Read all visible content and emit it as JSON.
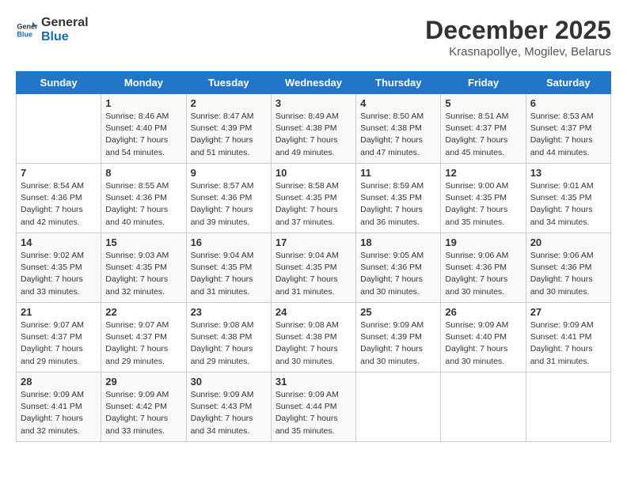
{
  "header": {
    "logo_general": "General",
    "logo_blue": "Blue",
    "title": "December 2025",
    "subtitle": "Krasnapollye, Mogilev, Belarus"
  },
  "weekdays": [
    "Sunday",
    "Monday",
    "Tuesday",
    "Wednesday",
    "Thursday",
    "Friday",
    "Saturday"
  ],
  "weeks": [
    [
      {
        "day": "",
        "info": ""
      },
      {
        "day": "1",
        "info": "Sunrise: 8:46 AM\nSunset: 4:40 PM\nDaylight: 7 hours\nand 54 minutes."
      },
      {
        "day": "2",
        "info": "Sunrise: 8:47 AM\nSunset: 4:39 PM\nDaylight: 7 hours\nand 51 minutes."
      },
      {
        "day": "3",
        "info": "Sunrise: 8:49 AM\nSunset: 4:38 PM\nDaylight: 7 hours\nand 49 minutes."
      },
      {
        "day": "4",
        "info": "Sunrise: 8:50 AM\nSunset: 4:38 PM\nDaylight: 7 hours\nand 47 minutes."
      },
      {
        "day": "5",
        "info": "Sunrise: 8:51 AM\nSunset: 4:37 PM\nDaylight: 7 hours\nand 45 minutes."
      },
      {
        "day": "6",
        "info": "Sunrise: 8:53 AM\nSunset: 4:37 PM\nDaylight: 7 hours\nand 44 minutes."
      }
    ],
    [
      {
        "day": "7",
        "info": "Sunrise: 8:54 AM\nSunset: 4:36 PM\nDaylight: 7 hours\nand 42 minutes."
      },
      {
        "day": "8",
        "info": "Sunrise: 8:55 AM\nSunset: 4:36 PM\nDaylight: 7 hours\nand 40 minutes."
      },
      {
        "day": "9",
        "info": "Sunrise: 8:57 AM\nSunset: 4:36 PM\nDaylight: 7 hours\nand 39 minutes."
      },
      {
        "day": "10",
        "info": "Sunrise: 8:58 AM\nSunset: 4:35 PM\nDaylight: 7 hours\nand 37 minutes."
      },
      {
        "day": "11",
        "info": "Sunrise: 8:59 AM\nSunset: 4:35 PM\nDaylight: 7 hours\nand 36 minutes."
      },
      {
        "day": "12",
        "info": "Sunrise: 9:00 AM\nSunset: 4:35 PM\nDaylight: 7 hours\nand 35 minutes."
      },
      {
        "day": "13",
        "info": "Sunrise: 9:01 AM\nSunset: 4:35 PM\nDaylight: 7 hours\nand 34 minutes."
      }
    ],
    [
      {
        "day": "14",
        "info": "Sunrise: 9:02 AM\nSunset: 4:35 PM\nDaylight: 7 hours\nand 33 minutes."
      },
      {
        "day": "15",
        "info": "Sunrise: 9:03 AM\nSunset: 4:35 PM\nDaylight: 7 hours\nand 32 minutes."
      },
      {
        "day": "16",
        "info": "Sunrise: 9:04 AM\nSunset: 4:35 PM\nDaylight: 7 hours\nand 31 minutes."
      },
      {
        "day": "17",
        "info": "Sunrise: 9:04 AM\nSunset: 4:35 PM\nDaylight: 7 hours\nand 31 minutes."
      },
      {
        "day": "18",
        "info": "Sunrise: 9:05 AM\nSunset: 4:36 PM\nDaylight: 7 hours\nand 30 minutes."
      },
      {
        "day": "19",
        "info": "Sunrise: 9:06 AM\nSunset: 4:36 PM\nDaylight: 7 hours\nand 30 minutes."
      },
      {
        "day": "20",
        "info": "Sunrise: 9:06 AM\nSunset: 4:36 PM\nDaylight: 7 hours\nand 30 minutes."
      }
    ],
    [
      {
        "day": "21",
        "info": "Sunrise: 9:07 AM\nSunset: 4:37 PM\nDaylight: 7 hours\nand 29 minutes."
      },
      {
        "day": "22",
        "info": "Sunrise: 9:07 AM\nSunset: 4:37 PM\nDaylight: 7 hours\nand 29 minutes."
      },
      {
        "day": "23",
        "info": "Sunrise: 9:08 AM\nSunset: 4:38 PM\nDaylight: 7 hours\nand 29 minutes."
      },
      {
        "day": "24",
        "info": "Sunrise: 9:08 AM\nSunset: 4:38 PM\nDaylight: 7 hours\nand 30 minutes."
      },
      {
        "day": "25",
        "info": "Sunrise: 9:09 AM\nSunset: 4:39 PM\nDaylight: 7 hours\nand 30 minutes."
      },
      {
        "day": "26",
        "info": "Sunrise: 9:09 AM\nSunset: 4:40 PM\nDaylight: 7 hours\nand 30 minutes."
      },
      {
        "day": "27",
        "info": "Sunrise: 9:09 AM\nSunset: 4:41 PM\nDaylight: 7 hours\nand 31 minutes."
      }
    ],
    [
      {
        "day": "28",
        "info": "Sunrise: 9:09 AM\nSunset: 4:41 PM\nDaylight: 7 hours\nand 32 minutes."
      },
      {
        "day": "29",
        "info": "Sunrise: 9:09 AM\nSunset: 4:42 PM\nDaylight: 7 hours\nand 33 minutes."
      },
      {
        "day": "30",
        "info": "Sunrise: 9:09 AM\nSunset: 4:43 PM\nDaylight: 7 hours\nand 34 minutes."
      },
      {
        "day": "31",
        "info": "Sunrise: 9:09 AM\nSunset: 4:44 PM\nDaylight: 7 hours\nand 35 minutes."
      },
      {
        "day": "",
        "info": ""
      },
      {
        "day": "",
        "info": ""
      },
      {
        "day": "",
        "info": ""
      }
    ]
  ]
}
